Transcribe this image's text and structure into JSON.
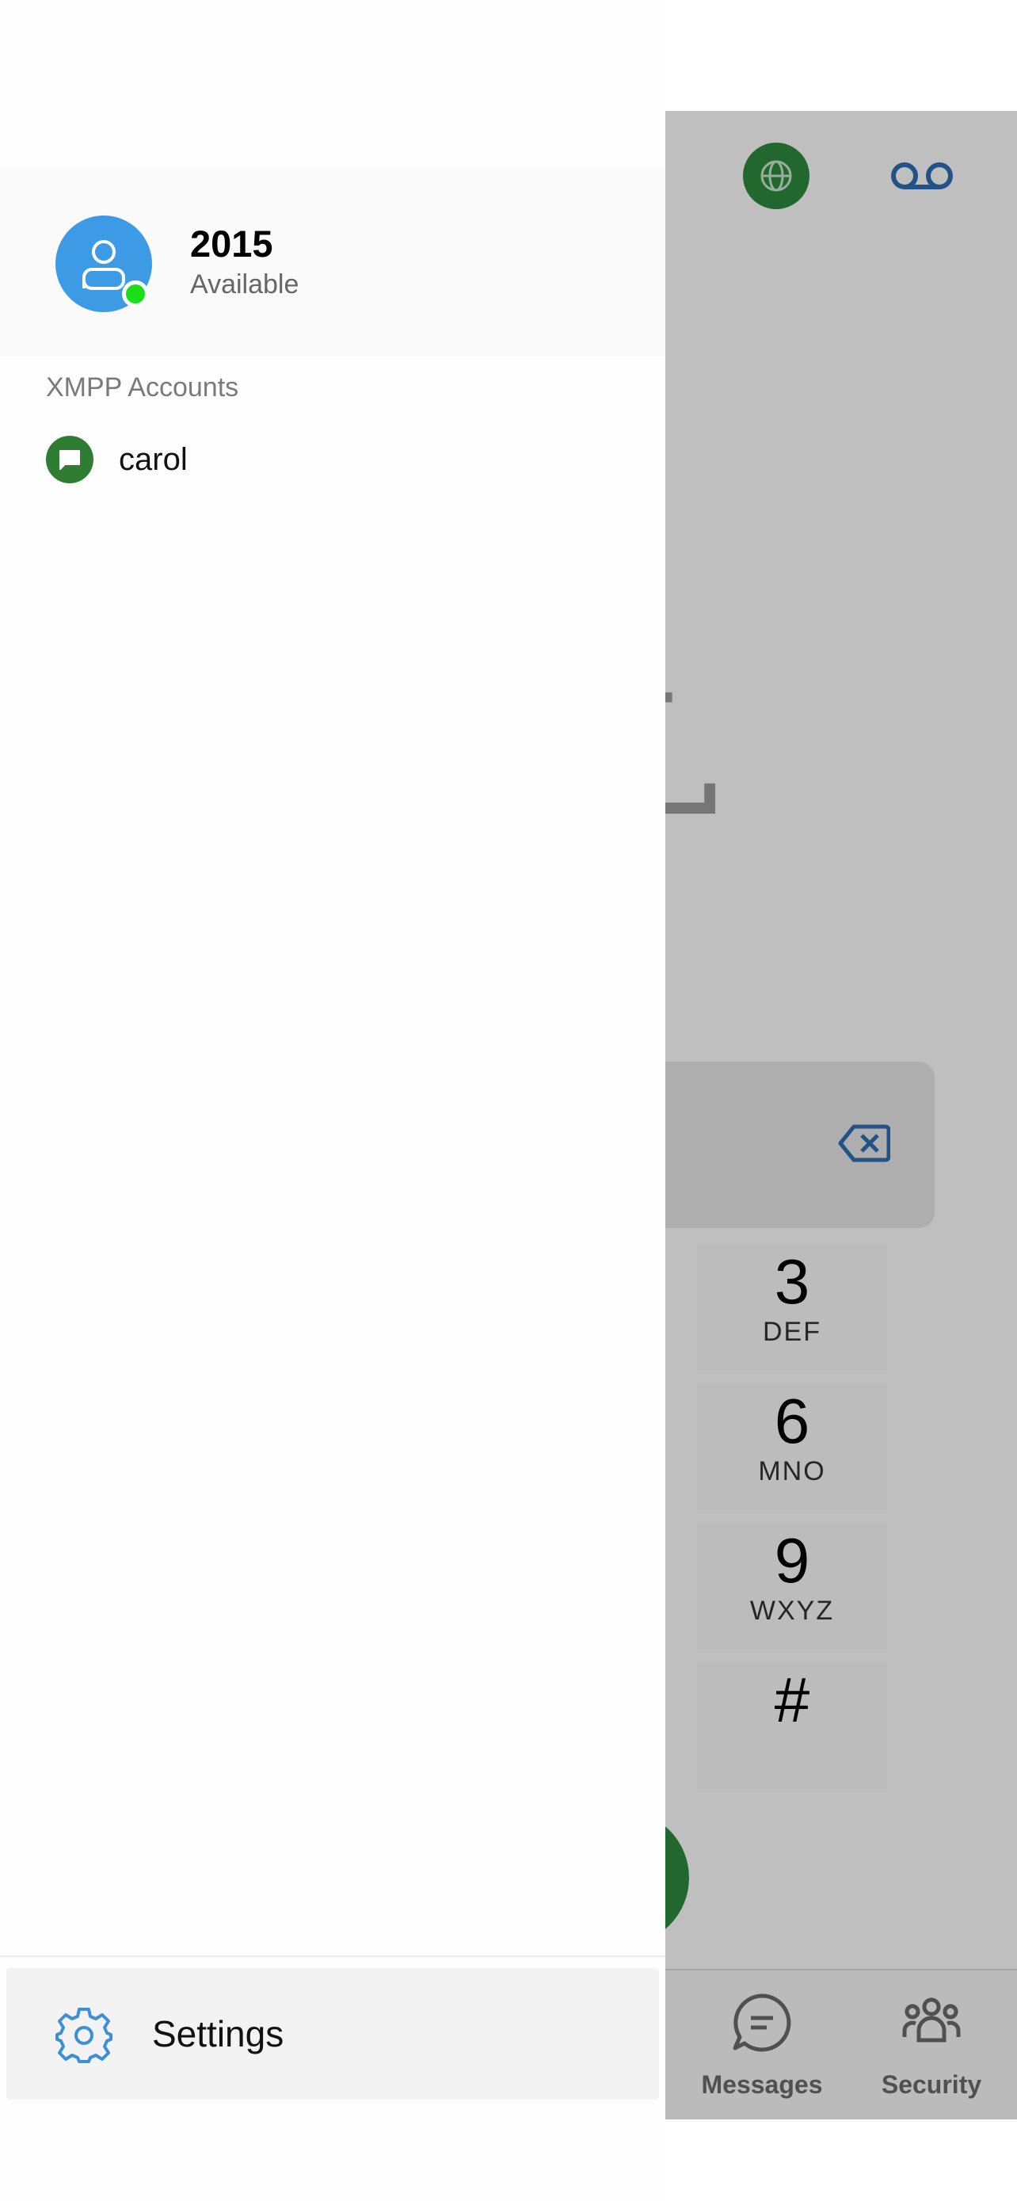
{
  "dial_screen": {
    "keys": [
      {
        "digit": "3",
        "letters": "DEF"
      },
      {
        "digit": "6",
        "letters": "MNO"
      },
      {
        "digit": "9",
        "letters": "WXYZ"
      },
      {
        "digit": "#",
        "letters": ""
      }
    ],
    "tabs": [
      {
        "label": "Messages",
        "icon": "message-icon"
      },
      {
        "label": "Security",
        "icon": "people-icon"
      }
    ]
  },
  "drawer": {
    "account": {
      "number": "2015",
      "status": "Available",
      "presence_color": "#19e019",
      "avatar_color": "#3d9be5"
    },
    "xmpp_section_label": "XMPP Accounts",
    "xmpp_accounts": [
      {
        "name": "carol",
        "icon": "chat-bubble-icon",
        "color": "#2e7d32"
      }
    ],
    "settings_label": "Settings"
  },
  "colors": {
    "accent_blue": "#3d8fd6",
    "green": "#2e8b3e"
  }
}
